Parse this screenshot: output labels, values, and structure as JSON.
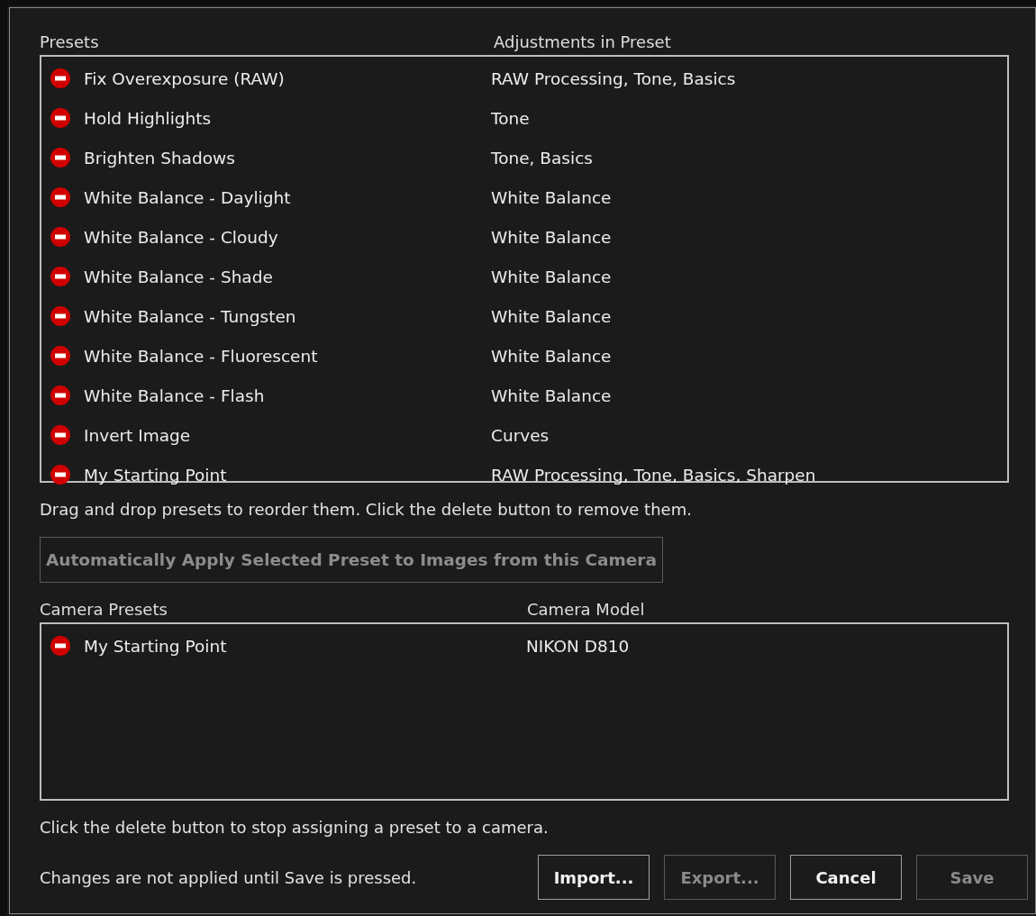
{
  "presets": {
    "columns": [
      "Presets",
      "Adjustments in Preset"
    ],
    "rows": [
      {
        "name": "Fix Overexposure (RAW)",
        "adjustments": "RAW Processing, Tone, Basics"
      },
      {
        "name": "Hold Highlights",
        "adjustments": "Tone"
      },
      {
        "name": "Brighten Shadows",
        "adjustments": "Tone, Basics"
      },
      {
        "name": "White Balance - Daylight",
        "adjustments": "White Balance"
      },
      {
        "name": "White Balance - Cloudy",
        "adjustments": "White Balance"
      },
      {
        "name": "White Balance - Shade",
        "adjustments": "White Balance"
      },
      {
        "name": "White Balance - Tungsten",
        "adjustments": "White Balance"
      },
      {
        "name": "White Balance - Fluorescent",
        "adjustments": "White Balance"
      },
      {
        "name": "White Balance - Flash",
        "adjustments": "White Balance"
      },
      {
        "name": "Invert Image",
        "adjustments": "Curves"
      },
      {
        "name": "My Starting Point",
        "adjustments": "RAW Processing, Tone, Basics, Sharpen"
      }
    ],
    "hint": "Drag and drop presets to reorder them. Click the delete button to remove them."
  },
  "auto_apply_button": {
    "label": "Automatically Apply Selected Preset to Images from this Camera",
    "disabled": true
  },
  "camera_presets": {
    "columns": [
      "Camera Presets",
      "Camera Model"
    ],
    "rows": [
      {
        "name": "My Starting Point",
        "model": "NIKON D810"
      }
    ],
    "hint": "Click the delete button to stop assigning a preset to a camera."
  },
  "footer_note": "Changes are not applied until Save is pressed.",
  "buttons": [
    {
      "label": "Import...",
      "disabled": false
    },
    {
      "label": "Export...",
      "disabled": true
    },
    {
      "label": "Cancel",
      "disabled": false
    },
    {
      "label": "Save",
      "disabled": true
    }
  ]
}
